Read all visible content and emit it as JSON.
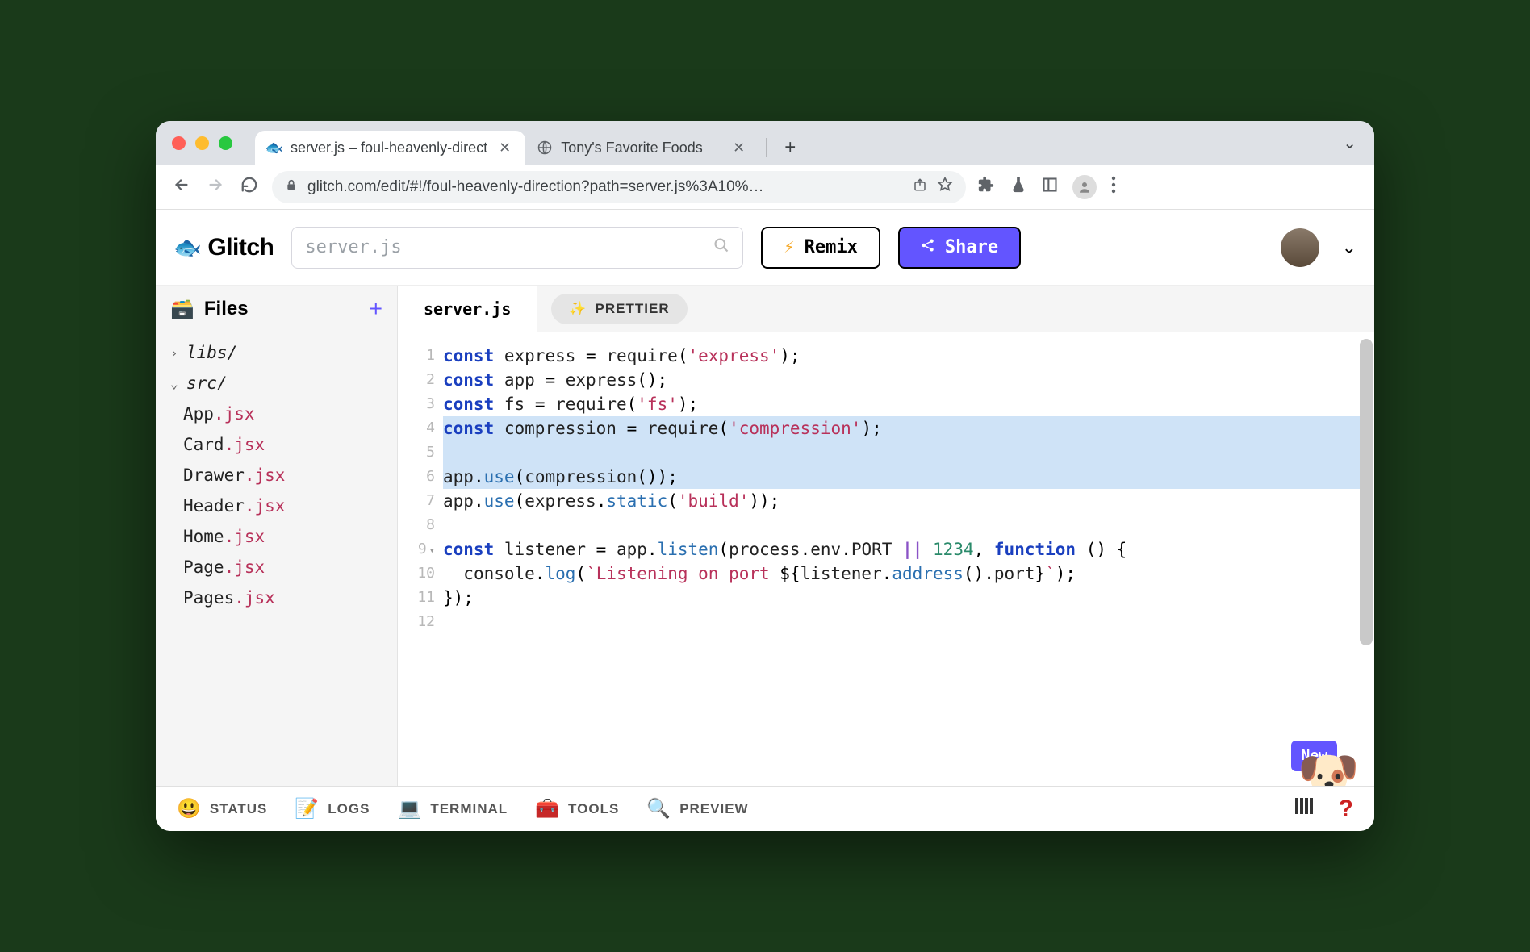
{
  "browser": {
    "tabs": [
      {
        "title": "server.js – foul-heavenly-direct",
        "active": true,
        "favicon": "🐟"
      },
      {
        "title": "Tony's Favorite Foods",
        "active": false,
        "favicon": "globe"
      }
    ],
    "new_tab": "+",
    "url": "glitch.com/edit/#!/foul-heavenly-direction?path=server.js%3A10%…",
    "nav": {
      "back": "←",
      "forward": "→",
      "reload": "⟳"
    }
  },
  "glitch": {
    "brand": "Glitch",
    "search_placeholder": "server.js",
    "remix_label": "Remix",
    "share_label": "Share"
  },
  "sidebar": {
    "header": "Files",
    "add": "+",
    "tree": [
      {
        "type": "folder",
        "name": "libs/",
        "expanded": false
      },
      {
        "type": "folder",
        "name": "src/",
        "expanded": true,
        "children": [
          {
            "base": "App",
            "ext": ".jsx"
          },
          {
            "base": "Card",
            "ext": ".jsx"
          },
          {
            "base": "Drawer",
            "ext": ".jsx"
          },
          {
            "base": "Header",
            "ext": ".jsx"
          },
          {
            "base": "Home",
            "ext": ".jsx"
          },
          {
            "base": "Page",
            "ext": ".jsx"
          },
          {
            "base": "Pages",
            "ext": ".jsx"
          }
        ]
      }
    ]
  },
  "editor": {
    "active_tab": "server.js",
    "prettier_label": "PRETTIER",
    "highlight_lines": [
      4,
      5,
      6
    ],
    "code_lines": [
      "const express = require('express');",
      "const app = express();",
      "const fs = require('fs');",
      "const compression = require('compression');",
      "",
      "app.use(compression());",
      "app.use(express.static('build'));",
      "",
      "const listener = app.listen(process.env.PORT || 1234, function () {",
      "  console.log(`Listening on port ${listener.address().port}`);",
      "});",
      ""
    ],
    "new_badge": "New"
  },
  "bottombar": {
    "items": [
      {
        "icon": "😃",
        "label": "STATUS"
      },
      {
        "icon": "📝",
        "label": "LOGS"
      },
      {
        "icon": "💻",
        "label": "TERMINAL"
      },
      {
        "icon": "🧰",
        "label": "TOOLS"
      },
      {
        "icon": "🔍",
        "label": "PREVIEW"
      }
    ],
    "help": "?"
  },
  "colors": {
    "accent": "#6355ff"
  }
}
